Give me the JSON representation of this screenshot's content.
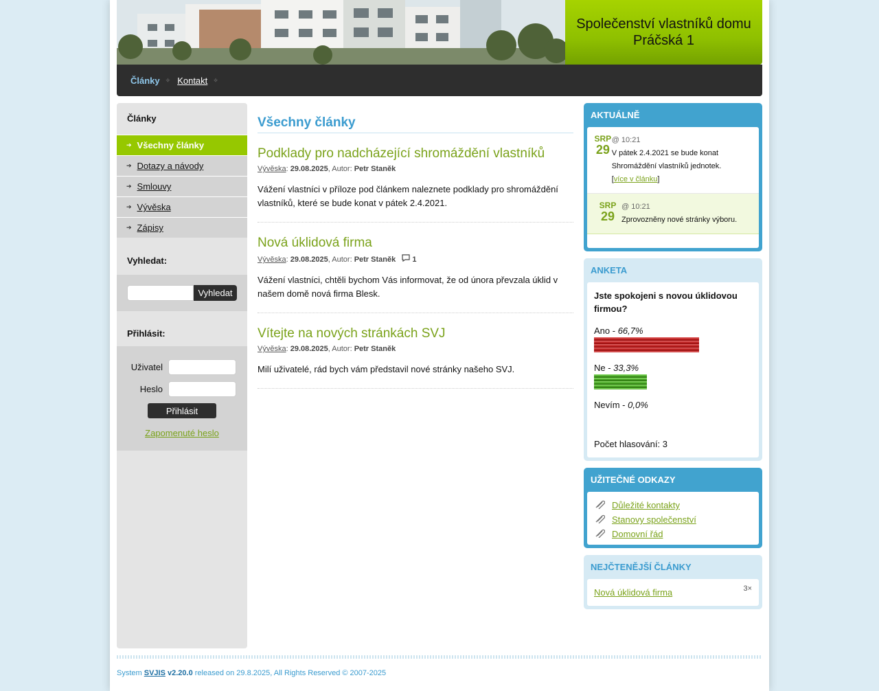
{
  "site": {
    "title_line1": "Společenství vlastníků domu",
    "title_line2": "Práčská 1"
  },
  "nav": {
    "items": [
      {
        "label": "Články",
        "active": true
      },
      {
        "label": "Kontakt",
        "active": false
      }
    ]
  },
  "sidebar": {
    "articles_heading": "Články",
    "menu": [
      {
        "label": "Všechny články",
        "active": true
      },
      {
        "label": "Dotazy a návody"
      },
      {
        "label": "Smlouvy"
      },
      {
        "label": "Vývěska"
      },
      {
        "label": "Zápisy"
      }
    ],
    "search_heading": "Vyhledat:",
    "search_input": {
      "value": "",
      "placeholder": ""
    },
    "search_button": "Vyhledat",
    "login_heading": "Přihlásit:",
    "user_label": "Uživatel",
    "password_label": "Heslo",
    "login_button": "Přihlásit",
    "forgot_link": "Zapomenuté heslo"
  },
  "main": {
    "heading": "Všechny články",
    "articles": [
      {
        "title": "Podklady pro nadcházející shromáždění vlastníků",
        "category": "Vývěska",
        "date": "29.08.2025",
        "author_prefix": ", Autor: ",
        "author": "Petr Staněk",
        "comments": "",
        "text": "Vážení vlastníci v příloze pod článkem naleznete podklady pro shromáždění vlastníků, které se bude konat v pátek 2.4.2021."
      },
      {
        "title": "Nová úklidová firma",
        "category": "Vývěska",
        "date": "29.08.2025",
        "author_prefix": ", Autor: ",
        "author": "Petr Staněk",
        "comments": "1",
        "text": "Vážení vlastníci, chtěli bychom Vás informovat, že od února převzala úklid v našem domě nová firma Blesk."
      },
      {
        "title": "Vítejte na nových stránkách SVJ",
        "category": "Vývěska",
        "date": "29.08.2025",
        "author_prefix": ", Autor: ",
        "author": "Petr Staněk",
        "comments": "",
        "text": "Milí uživatelé, rád bych vám představil nové stránky našeho SVJ."
      }
    ]
  },
  "news": {
    "heading": "AKTUÁLNĚ",
    "items": [
      {
        "month": "SRP",
        "day": "29",
        "time": "@ 10:21",
        "text": "V pátek 2.4.2021 se bude konat Shromáždění vlastníků jednotek.",
        "more_link": "více v článku"
      },
      {
        "month": "SRP",
        "day": "29",
        "time": "@ 10:21",
        "text": "Zprovozněny nové stránky výboru.",
        "more_link": ""
      }
    ]
  },
  "poll": {
    "heading": "ANKETA",
    "question": "Jste spokojeni s novou úklidovou firmou?",
    "options": [
      {
        "label": "Ano - ",
        "percent_text": "66,7%",
        "percent": 66.7,
        "color": "red"
      },
      {
        "label": "Ne - ",
        "percent_text": "33,3%",
        "percent": 33.3,
        "color": "green"
      },
      {
        "label": "Nevím - ",
        "percent_text": "0,0%",
        "percent": 0.0,
        "color": "empty"
      }
    ],
    "total": "Počet hlasování: 3"
  },
  "useful_links": {
    "heading": "UŽITEČNÉ ODKAZY",
    "items": [
      "Důležité kontakty",
      "Stanovy společenství",
      "Domovní řád"
    ]
  },
  "popular": {
    "heading": "NEJČTENĚJŠÍ ČLÁNKY",
    "title": "Nová úklidová firma",
    "count": "3×"
  },
  "footer": {
    "prefix": "System ",
    "system": "SVJIS",
    "version": "v2.20.0",
    "suffix": " released on 29.8.2025, All Rights Reserved © 2007-2025"
  },
  "colors": {
    "accent_green": "#96c800",
    "link_green": "#7aa21a",
    "accent_blue": "#41a3cf",
    "nav_dark": "#2e2e2e"
  }
}
